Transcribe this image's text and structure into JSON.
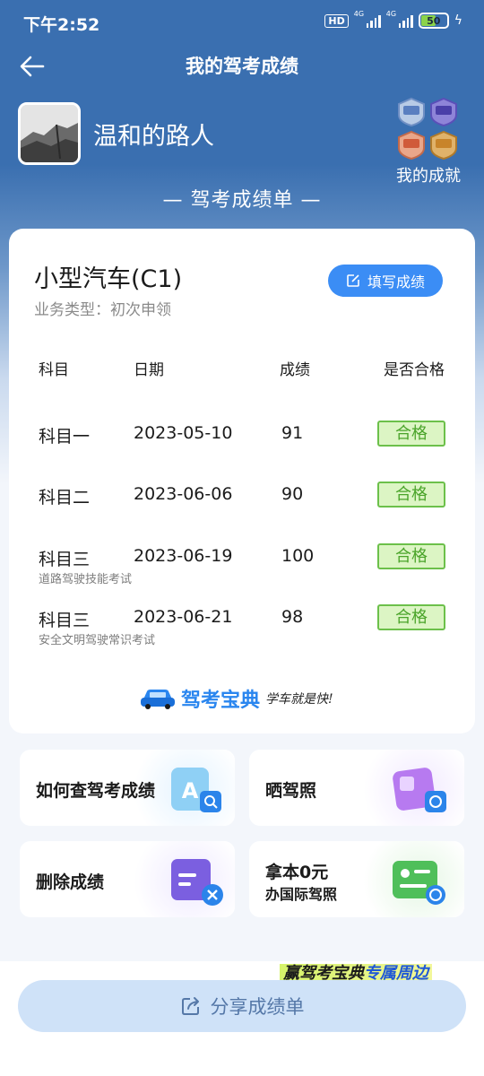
{
  "status_bar": {
    "time": "下午2:52",
    "hd": "HD",
    "net1": "4G",
    "net2": "4G",
    "battery": "50"
  },
  "header": {
    "title": "我的驾考成绩",
    "back_icon": "arrow-left-icon"
  },
  "profile": {
    "username": "温和的路人",
    "achievements_label": "我的成就"
  },
  "sheet_title": "— 驾考成绩单 —",
  "card": {
    "vehicle": "小型汽车(C1)",
    "business_type": "业务类型：初次申领",
    "fill_button": "填写成绩",
    "columns": [
      "科目",
      "日期",
      "成绩",
      "是否合格"
    ],
    "rows": [
      {
        "subject": "科目一",
        "date": "2023-05-10",
        "score": "91",
        "status": "合格",
        "note": ""
      },
      {
        "subject": "科目二",
        "date": "2023-06-06",
        "score": "90",
        "status": "合格",
        "note": ""
      },
      {
        "subject": "科目三",
        "date": "2023-06-19",
        "score": "100",
        "status": "合格",
        "note": "道路驾驶技能考试"
      },
      {
        "subject": "科目三",
        "date": "2023-06-21",
        "score": "98",
        "status": "合格",
        "note": "安全文明驾驶常识考试"
      }
    ],
    "brand_name": "驾考宝典",
    "brand_slogan": "学车就是快!"
  },
  "tiles": {
    "query": "如何查驾考成绩",
    "show_license": "晒驾照",
    "delete": "删除成绩",
    "intl_line1": "拿本0元",
    "intl_line2": "办国际驾照"
  },
  "promo": {
    "part1": "赢驾考宝典",
    "part2": "专属周边"
  },
  "share_button": "分享成绩单",
  "colors": {
    "header_blue": "#3a6fb0",
    "primary_button": "#3b8df5",
    "pass_green": "#4aa42a",
    "share_bg": "#cfe2f8"
  }
}
